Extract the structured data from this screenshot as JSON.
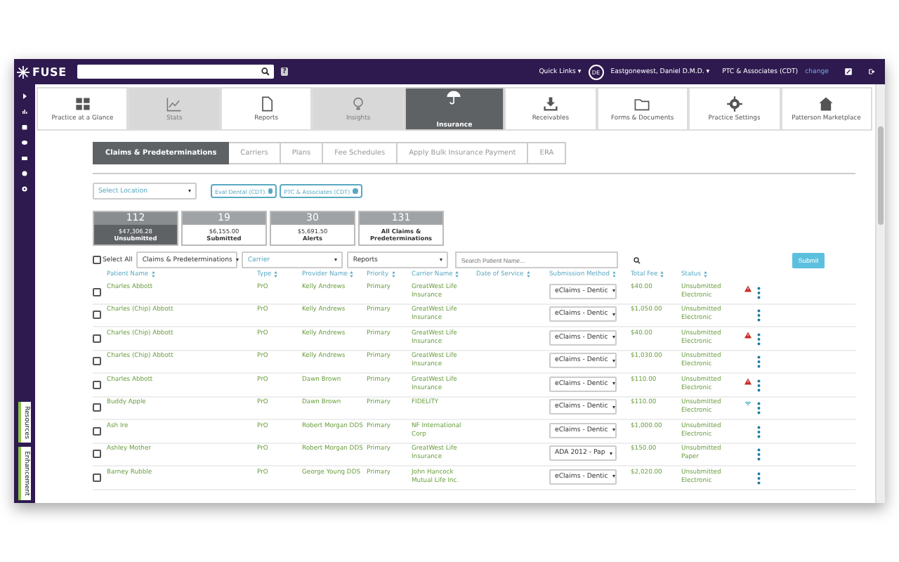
{
  "header": {
    "logo": "FUSE",
    "help": "?",
    "quick_links": "Quick Links ▾",
    "avatar": "DE",
    "user": "Eastgonewest, Daniel D.M.D. ▾",
    "practice": "PTC & Associates (CDT)",
    "change": "change"
  },
  "nav_tiles": [
    {
      "label": "Practice at a Glance",
      "selected": false,
      "disabled": false
    },
    {
      "label": "Stats",
      "selected": false,
      "disabled": true
    },
    {
      "label": "Reports",
      "selected": false,
      "disabled": false
    },
    {
      "label": "Insights",
      "selected": false,
      "disabled": true
    },
    {
      "label": "Insurance",
      "selected": true,
      "disabled": false
    },
    {
      "label": "Receivables",
      "selected": false,
      "disabled": false
    },
    {
      "label": "Forms & Documents",
      "selected": false,
      "disabled": false
    },
    {
      "label": "Practice Settings",
      "selected": false,
      "disabled": false
    },
    {
      "label": "Patterson Marketplace",
      "selected": false,
      "disabled": false
    }
  ],
  "side_tabs": [
    "Resources",
    "Enhancement"
  ],
  "tabs": [
    {
      "label": "Claims & Predeterminations",
      "selected": true
    },
    {
      "label": "Carriers",
      "selected": false
    },
    {
      "label": "Plans",
      "selected": false
    },
    {
      "label": "Fee Schedules",
      "selected": false
    },
    {
      "label": "Apply Bulk Insurance Payment",
      "selected": false
    },
    {
      "label": "ERA",
      "selected": false
    }
  ],
  "location_select": {
    "placeholder": "Select Location"
  },
  "location_chips": [
    "Eval Dental (CDT)",
    "PTC & Associates (CDT)"
  ],
  "summary_cards": [
    {
      "count": "112",
      "amount": "$47,306.28",
      "label": "Unsubmitted",
      "selected": true
    },
    {
      "count": "19",
      "amount": "$6,155.00",
      "label": "Submitted",
      "selected": false
    },
    {
      "count": "30",
      "amount": "$5,691.50",
      "label": "Alerts",
      "selected": false
    },
    {
      "count": "131",
      "label": "All Claims & Predeterminations",
      "selected": false
    }
  ],
  "filters": {
    "select_all": {
      "label": "Select All",
      "checked": false
    },
    "claim_type": "Claims & Predeterminations",
    "carrier": {
      "placeholder": "Carrier"
    },
    "reports": "Reports",
    "patient_search": {
      "placeholder": "Search Patient Name..."
    },
    "submit": "Submit"
  },
  "table": {
    "columns": [
      "Patient Name",
      "Type",
      "Provider Name",
      "Priority",
      "Carrier Name",
      "Date of Service",
      "Submission Method",
      "Total Fee",
      "Status"
    ],
    "rows": [
      {
        "checked": false,
        "patient": "Charles Abbott",
        "type": "PrO",
        "provider": "Kelly Andrews",
        "priority": "Primary",
        "carrier": "GreatWest Life Insurance",
        "method": "eClaims - Dentic",
        "fee": "$40.00",
        "status": "Unsubmitted Electronic",
        "warning": true,
        "signal": false
      },
      {
        "checked": false,
        "patient": "Charles (Chip) Abbott",
        "type": "PrO",
        "provider": "Kelly Andrews",
        "priority": "Primary",
        "carrier": "GreatWest Life Insurance",
        "method": "eClaims - Dentic",
        "fee": "$1,050.00",
        "status": "Unsubmitted Electronic",
        "warning": false,
        "signal": false
      },
      {
        "checked": false,
        "patient": "Charles (Chip) Abbott",
        "type": "PrO",
        "provider": "Kelly Andrews",
        "priority": "Primary",
        "carrier": "GreatWest Life Insurance",
        "method": "eClaims - Dentic",
        "fee": "$40.00",
        "status": "Unsubmitted Electronic",
        "warning": true,
        "signal": false
      },
      {
        "checked": false,
        "patient": "Charles (Chip) Abbott",
        "type": "PrO",
        "provider": "Kelly Andrews",
        "priority": "Primary",
        "carrier": "GreatWest Life Insurance",
        "method": "eClaims - Dentic",
        "fee": "$1,030.00",
        "status": "Unsubmitted Electronic",
        "warning": false,
        "signal": false
      },
      {
        "checked": false,
        "patient": "Charles Abbott",
        "type": "PrO",
        "provider": "Dawn Brown",
        "priority": "Primary",
        "carrier": "GreatWest Life Insurance",
        "method": "eClaims - Dentic",
        "fee": "$110.00",
        "status": "Unsubmitted Electronic",
        "warning": true,
        "signal": false
      },
      {
        "checked": false,
        "patient": "Buddy Apple",
        "type": "PrO",
        "provider": "Dawn Brown",
        "priority": "Primary",
        "carrier": "FIDELITY",
        "method": "eClaims - Dentic",
        "fee": "$110.00",
        "status": "Unsubmitted Electronic",
        "warning": false,
        "signal": true
      },
      {
        "checked": false,
        "patient": "Ash Ire",
        "type": "PrO",
        "provider": "Robert Morgan DDS",
        "priority": "Primary",
        "carrier": "NF International Corp",
        "method": "eClaims - Dentic",
        "fee": "$1,000.00",
        "status": "Unsubmitted Electronic",
        "warning": false,
        "signal": false
      },
      {
        "checked": false,
        "patient": "Ashley Mother",
        "type": "PrO",
        "provider": "Robert Morgan DDS",
        "priority": "Primary",
        "carrier": "GreatWest Life Insurance",
        "method": "ADA 2012 - Pap",
        "fee": "$150.00",
        "status": "Unsubmitted Paper",
        "warning": false,
        "signal": false
      },
      {
        "checked": false,
        "patient": "Barney Rubble",
        "type": "PrO",
        "provider": "George Young DDS",
        "priority": "Primary",
        "carrier": "John Hancock Mutual Life Inc.",
        "method": "eClaims - Dentic",
        "fee": "$2,020.00",
        "status": "Unsubmitted Electronic",
        "warning": false,
        "signal": false
      }
    ]
  }
}
